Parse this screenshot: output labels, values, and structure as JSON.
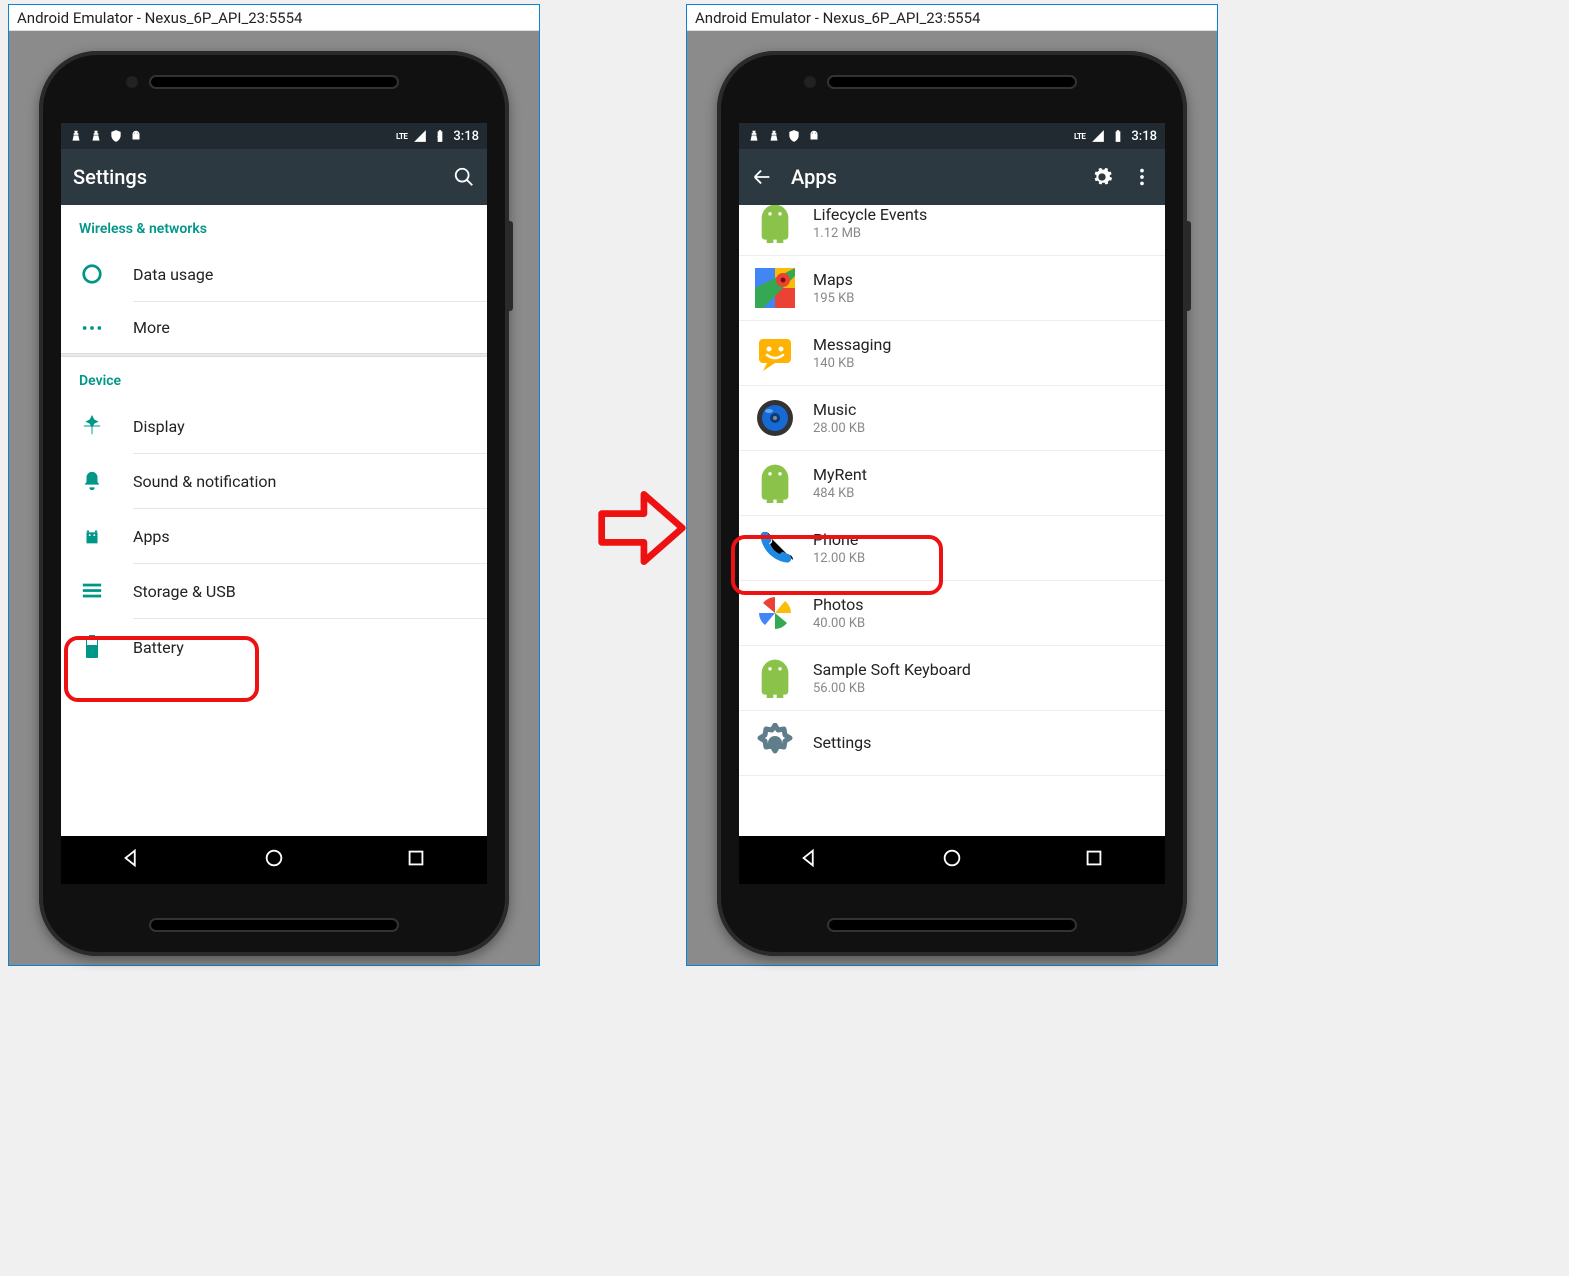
{
  "emulator_title": "Android Emulator - Nexus_6P_API_23:5554",
  "status_time": "3:18",
  "status_lte": "LTE",
  "left": {
    "appbar_title": "Settings",
    "section1_header": "Wireless & networks",
    "section1_items": [
      {
        "label": "Data usage"
      },
      {
        "label": "More"
      }
    ],
    "section2_header": "Device",
    "section2_items": [
      {
        "label": "Display"
      },
      {
        "label": "Sound & notification"
      },
      {
        "label": "Apps"
      },
      {
        "label": "Storage & USB"
      },
      {
        "label": "Battery"
      }
    ]
  },
  "right": {
    "appbar_title": "Apps",
    "apps": [
      {
        "name": "Lifecycle Events",
        "size": "1.12 MB"
      },
      {
        "name": "Maps",
        "size": "195 KB"
      },
      {
        "name": "Messaging",
        "size": "140 KB"
      },
      {
        "name": "Music",
        "size": "28.00 KB"
      },
      {
        "name": "MyRent",
        "size": "484 KB"
      },
      {
        "name": "Phone",
        "size": "12.00 KB"
      },
      {
        "name": "Photos",
        "size": "40.00 KB"
      },
      {
        "name": "Sample Soft Keyboard",
        "size": "56.00 KB"
      },
      {
        "name": "Settings",
        "size": ""
      }
    ]
  }
}
